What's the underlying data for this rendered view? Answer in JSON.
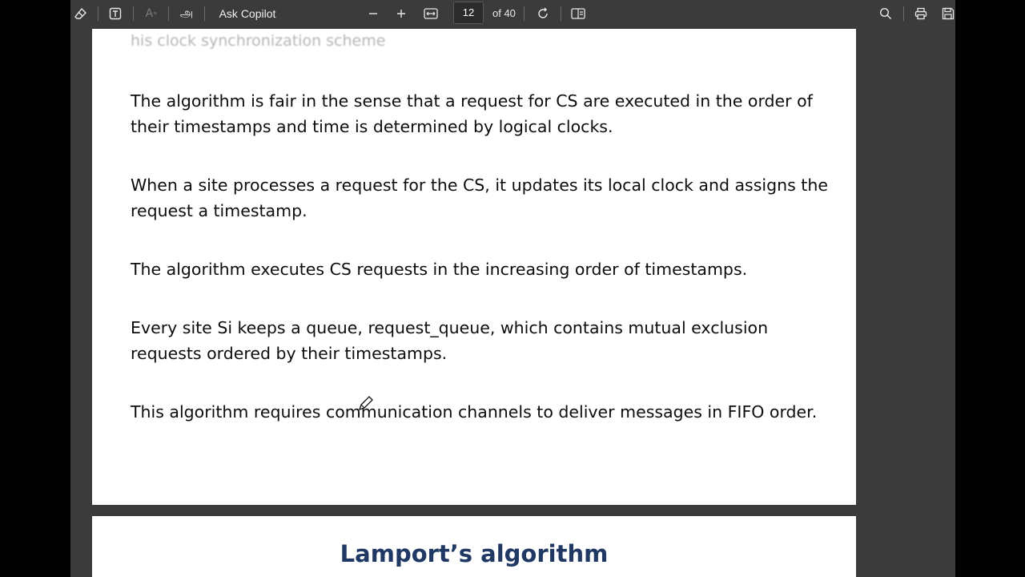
{
  "toolbar": {
    "ask_copilot_label": "Ask Copilot",
    "page_number": "12",
    "page_total": "of 40",
    "icons": [
      "eraser-icon",
      "text-box-icon",
      "read-aloud-icon",
      "translate-icon",
      "zoom-out-icon",
      "zoom-in-icon",
      "fit-width-icon",
      "rotate-icon",
      "page-view-icon",
      "search-icon",
      "print-icon",
      "save-icon"
    ],
    "translate_glyph": "அ",
    "read_aloud_glyph": "A"
  },
  "document": {
    "faded_top_line": "his clock synchronization scheme",
    "paragraphs": [
      "The algorithm is fair in the sense that a request for CS are executed in the order of their timestamps and time is determined by logical clocks.",
      "When a site processes a request for the CS, it updates its local clock and assigns the request a timestamp.",
      "The algorithm executes CS requests in the increasing order of timestamps.",
      "Every site Si keeps a queue, request_queue, which contains mutual exclusion requests ordered by their timestamps.",
      "This algorithm requires communication channels to deliver messages in FIFO order."
    ],
    "next_slide_title": "Lamport’s algorithm"
  },
  "colors": {
    "toolbar_bg": "#3b3b3b",
    "title_color": "#1f3864"
  }
}
